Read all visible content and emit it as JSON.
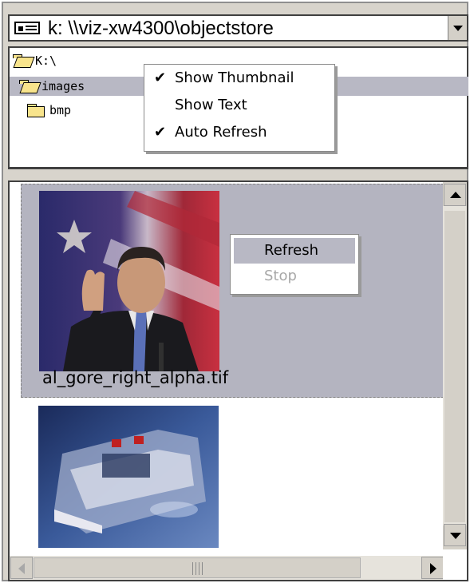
{
  "combo": {
    "icon": "drive-icon",
    "path": "k: \\\\viz-xw4300\\objectstore"
  },
  "tree": {
    "items": [
      {
        "label": "K:\\",
        "icon": "open-folder-icon"
      },
      {
        "label": "images",
        "icon": "open-folder-icon",
        "selected": true
      },
      {
        "label": "bmp",
        "icon": "folder-icon"
      }
    ]
  },
  "view_menu": {
    "items": [
      {
        "label": "Show Thumbnail",
        "checked": true
      },
      {
        "label": "Show Text",
        "checked": false
      },
      {
        "label": "Auto Refresh",
        "checked": true
      }
    ],
    "check_glyph": "✔"
  },
  "thumbnails": {
    "items": [
      {
        "label": "al_gore_right_alpha.tif",
        "selected": true
      },
      {
        "label": "",
        "selected": false
      }
    ]
  },
  "refresh_menu": {
    "items": [
      {
        "label": "Refresh",
        "hover": true,
        "disabled": false
      },
      {
        "label": "Stop",
        "hover": false,
        "disabled": true
      }
    ]
  },
  "colors": {
    "selection": "#b4b4c0",
    "folder": "#f8e48c",
    "disabled_text": "#a8a8a8"
  }
}
